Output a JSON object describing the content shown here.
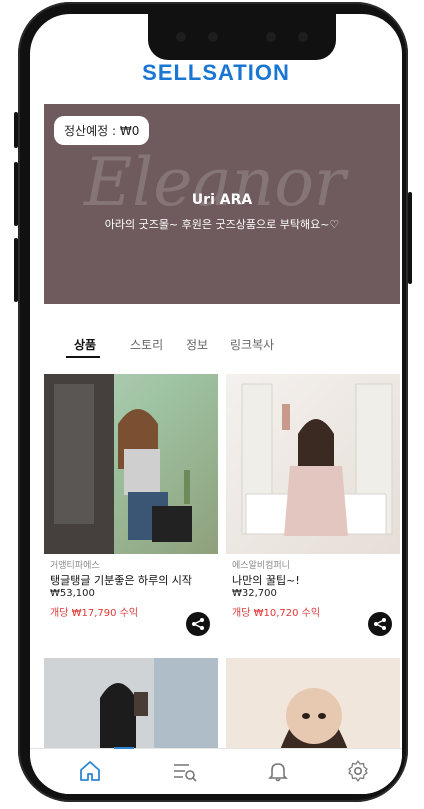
{
  "app": {
    "brand": "SELLSATION"
  },
  "banner": {
    "balance_label": "정산예정 : ₩0",
    "title": "Uri ARA",
    "subtitle": "아라의 굿즈몰~ 후원은 굿즈상품으로 부탁해요~♡",
    "background_text": "Eleanor"
  },
  "tabs": [
    "상품",
    "스토리",
    "정보",
    "링크복사"
  ],
  "products": [
    {
      "seller": "거앵티파에스",
      "title": "탱글탱글 기분좋은 하루의 시작",
      "price": "₩53,100",
      "earn": "개당 ₩17,790 수익"
    },
    {
      "seller": "에스알비컴퍼니",
      "title": "나만의 꿀팁~!",
      "price": "₩32,700",
      "earn": "개당 ₩10,720 수익"
    }
  ],
  "bottom_nav": [
    "home-icon",
    "menu-search-icon",
    "bell-icon",
    "settings-icon"
  ],
  "colors": {
    "accent": "#1976d2",
    "banner": "#6f5b5d",
    "earn": "#e13838"
  }
}
